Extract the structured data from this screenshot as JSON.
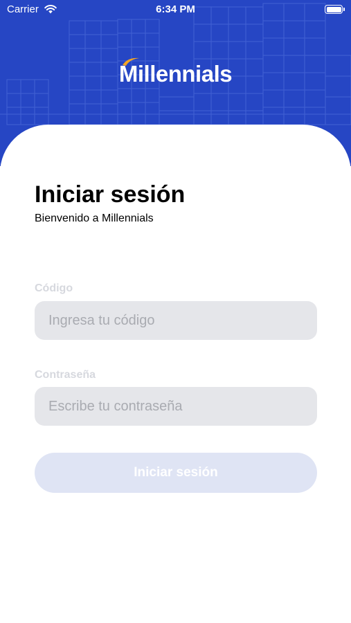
{
  "status_bar": {
    "carrier": "Carrier",
    "time": "6:34 PM"
  },
  "header": {
    "logo_text": "Millennials",
    "background_color": "#2646c4",
    "logo_accent_color": "#f5a623"
  },
  "login": {
    "title": "Iniciar sesión",
    "subtitle": "Bienvenido a Millennials",
    "code_label": "Código",
    "code_placeholder": "Ingresa tu código",
    "password_label": "Contraseña",
    "password_placeholder": "Escribe tu contraseña",
    "submit_label": "Iniciar sesión"
  }
}
